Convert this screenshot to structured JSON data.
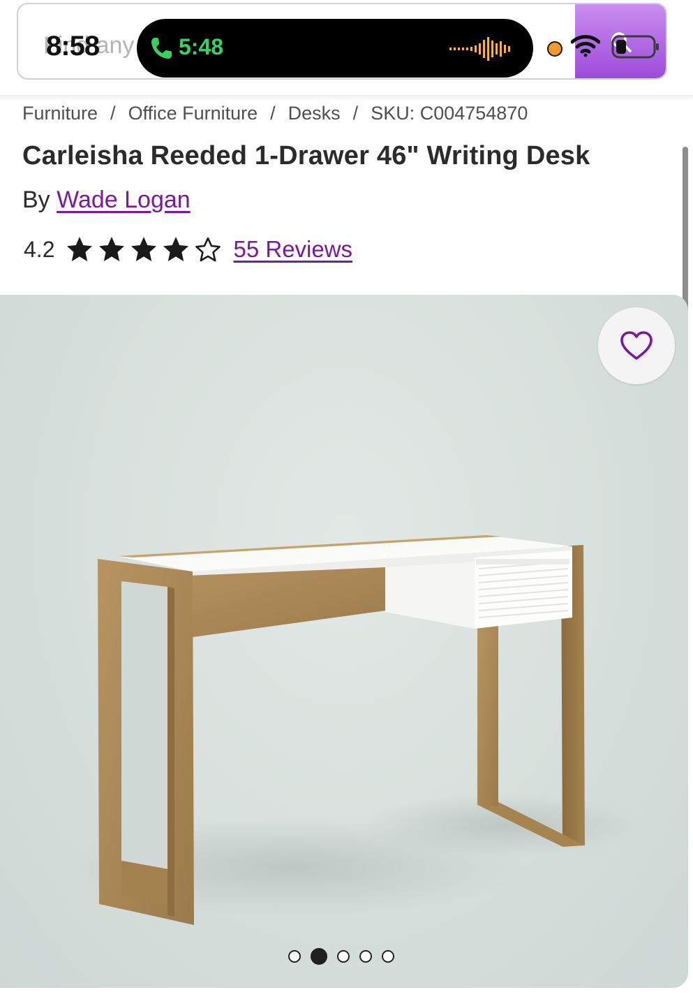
{
  "status_bar": {
    "time": "8:58",
    "call_time": "5:48",
    "icons": [
      "phone-icon",
      "audio-wave-icon",
      "recording-dot-icon",
      "wifi-icon",
      "battery-icon"
    ]
  },
  "search": {
    "ghost_text": "Find any"
  },
  "breadcrumb": {
    "items": [
      "Furniture",
      "Office Furniture",
      "Desks"
    ],
    "separator": "/",
    "sku": "SKU: C004754870"
  },
  "product": {
    "title": "Carleisha Reeded 1-Drawer 46\" Writing Desk",
    "by_label": "By",
    "brand": "Wade Logan",
    "rating": "4.2",
    "rating_value": 4.2,
    "stars_filled": 4,
    "stars_total": 5,
    "reviews_label": "55 Reviews"
  },
  "gallery": {
    "image_count": 5,
    "active_index": 1,
    "favorite_icon": "heart-outline-icon"
  },
  "colors": {
    "brand_purple": "#7b189f",
    "call_green": "#36d160",
    "image_background": "#d7dfdc"
  }
}
